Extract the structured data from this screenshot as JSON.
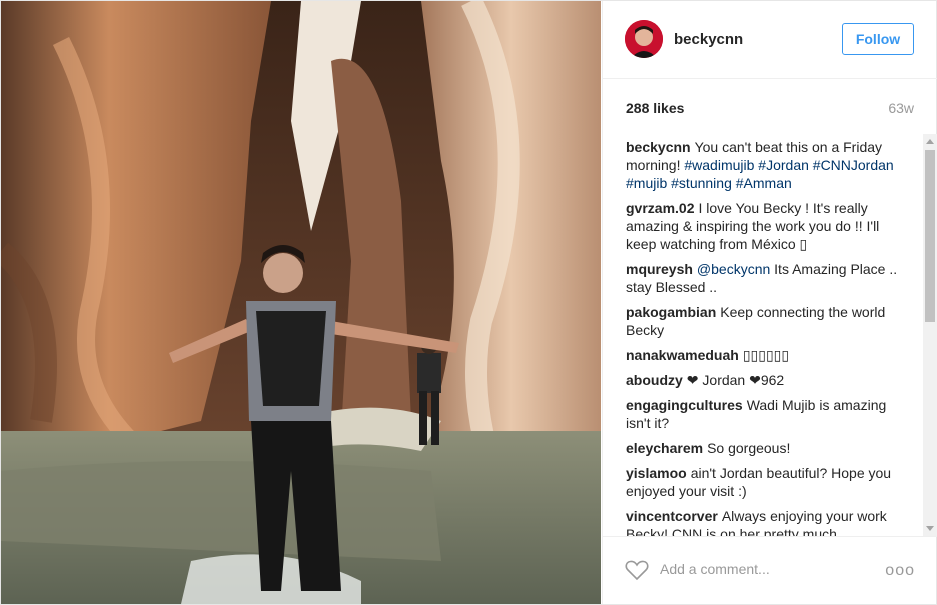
{
  "post": {
    "username": "beckycnn",
    "follow_label": "Follow",
    "likes": "288 likes",
    "age": "63w",
    "comments": [
      {
        "user": "beckycnn",
        "text": "You can't beat this on a Friday morning! #wadimujib #Jordan #CNNJordan #mujib #stunning #Amman"
      },
      {
        "user": "gvrzam.02",
        "text": "I love You Becky ! It's really amazing & inspiring the work you do !! I'll keep watching from México ▯"
      },
      {
        "user": "mqureysh",
        "text": "@beckycnn Its Amazing Place .. stay Blessed .."
      },
      {
        "user": "pakogambian",
        "text": "Keep connecting the world Becky"
      },
      {
        "user": "nanakwameduah",
        "text": "▯▯▯▯▯▯"
      },
      {
        "user": "aboudzy",
        "text": "❤ Jordan ❤962"
      },
      {
        "user": "engagingcultures",
        "text": "Wadi Mujib is amazing isn't it?"
      },
      {
        "user": "eleycharem",
        "text": "So gorgeous!"
      },
      {
        "user": "yislamoo",
        "text": "ain't Jordan beautiful? Hope you enjoyed your visit :)"
      },
      {
        "user": "vincentcorver",
        "text": "Always enjoying your work Becky! CNN is on her pretty much"
      }
    ],
    "comment_placeholder": "Add a comment...",
    "more_label": "ooo"
  },
  "colors": {
    "accent": "#3897f0",
    "hashtag": "#003569",
    "avatar_bg": "#c8102e"
  },
  "icons": {
    "like": "heart-icon",
    "more": "more-options-icon"
  }
}
